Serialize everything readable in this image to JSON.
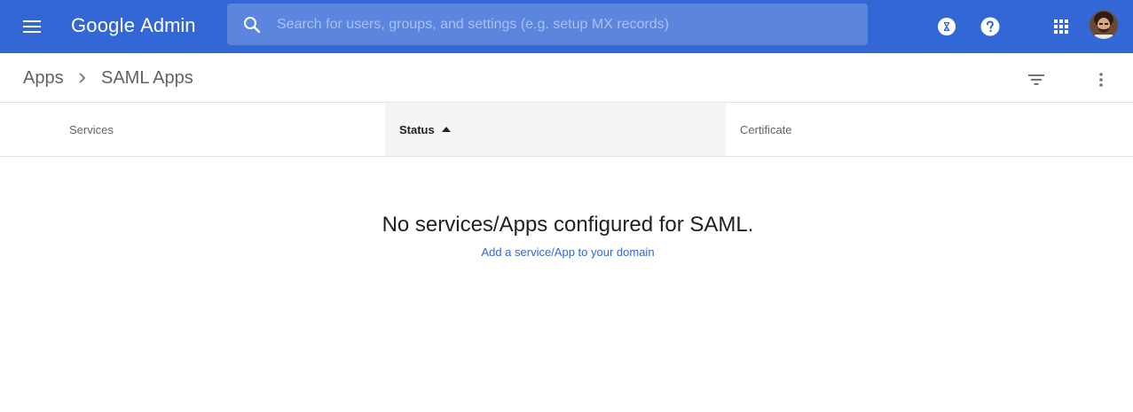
{
  "header": {
    "brand_google": "Google",
    "brand_admin": "Admin",
    "search_placeholder": "Search for users, groups, and settings (e.g. setup MX records)",
    "accent_color": "#3367d6",
    "icons": [
      "menu-icon",
      "search-icon",
      "hourglass-icon",
      "help-icon",
      "apps-grid-icon",
      "avatar"
    ]
  },
  "breadcrumb": {
    "parent": "Apps",
    "current": "SAML Apps",
    "separator_icon": "chevron-right-icon"
  },
  "toolbar": {
    "icons": [
      "filter-icon",
      "more-vert-icon"
    ]
  },
  "table": {
    "columns": [
      {
        "label": "Services",
        "sorted": false
      },
      {
        "label": "Status",
        "sorted": true,
        "sort_direction": "ascending"
      },
      {
        "label": "Certificate",
        "sorted": false
      }
    ],
    "rows": []
  },
  "empty_state": {
    "title": "No services/Apps configured for SAML.",
    "link_text": "Add a service/App to your domain",
    "link_color": "#3367d6"
  }
}
